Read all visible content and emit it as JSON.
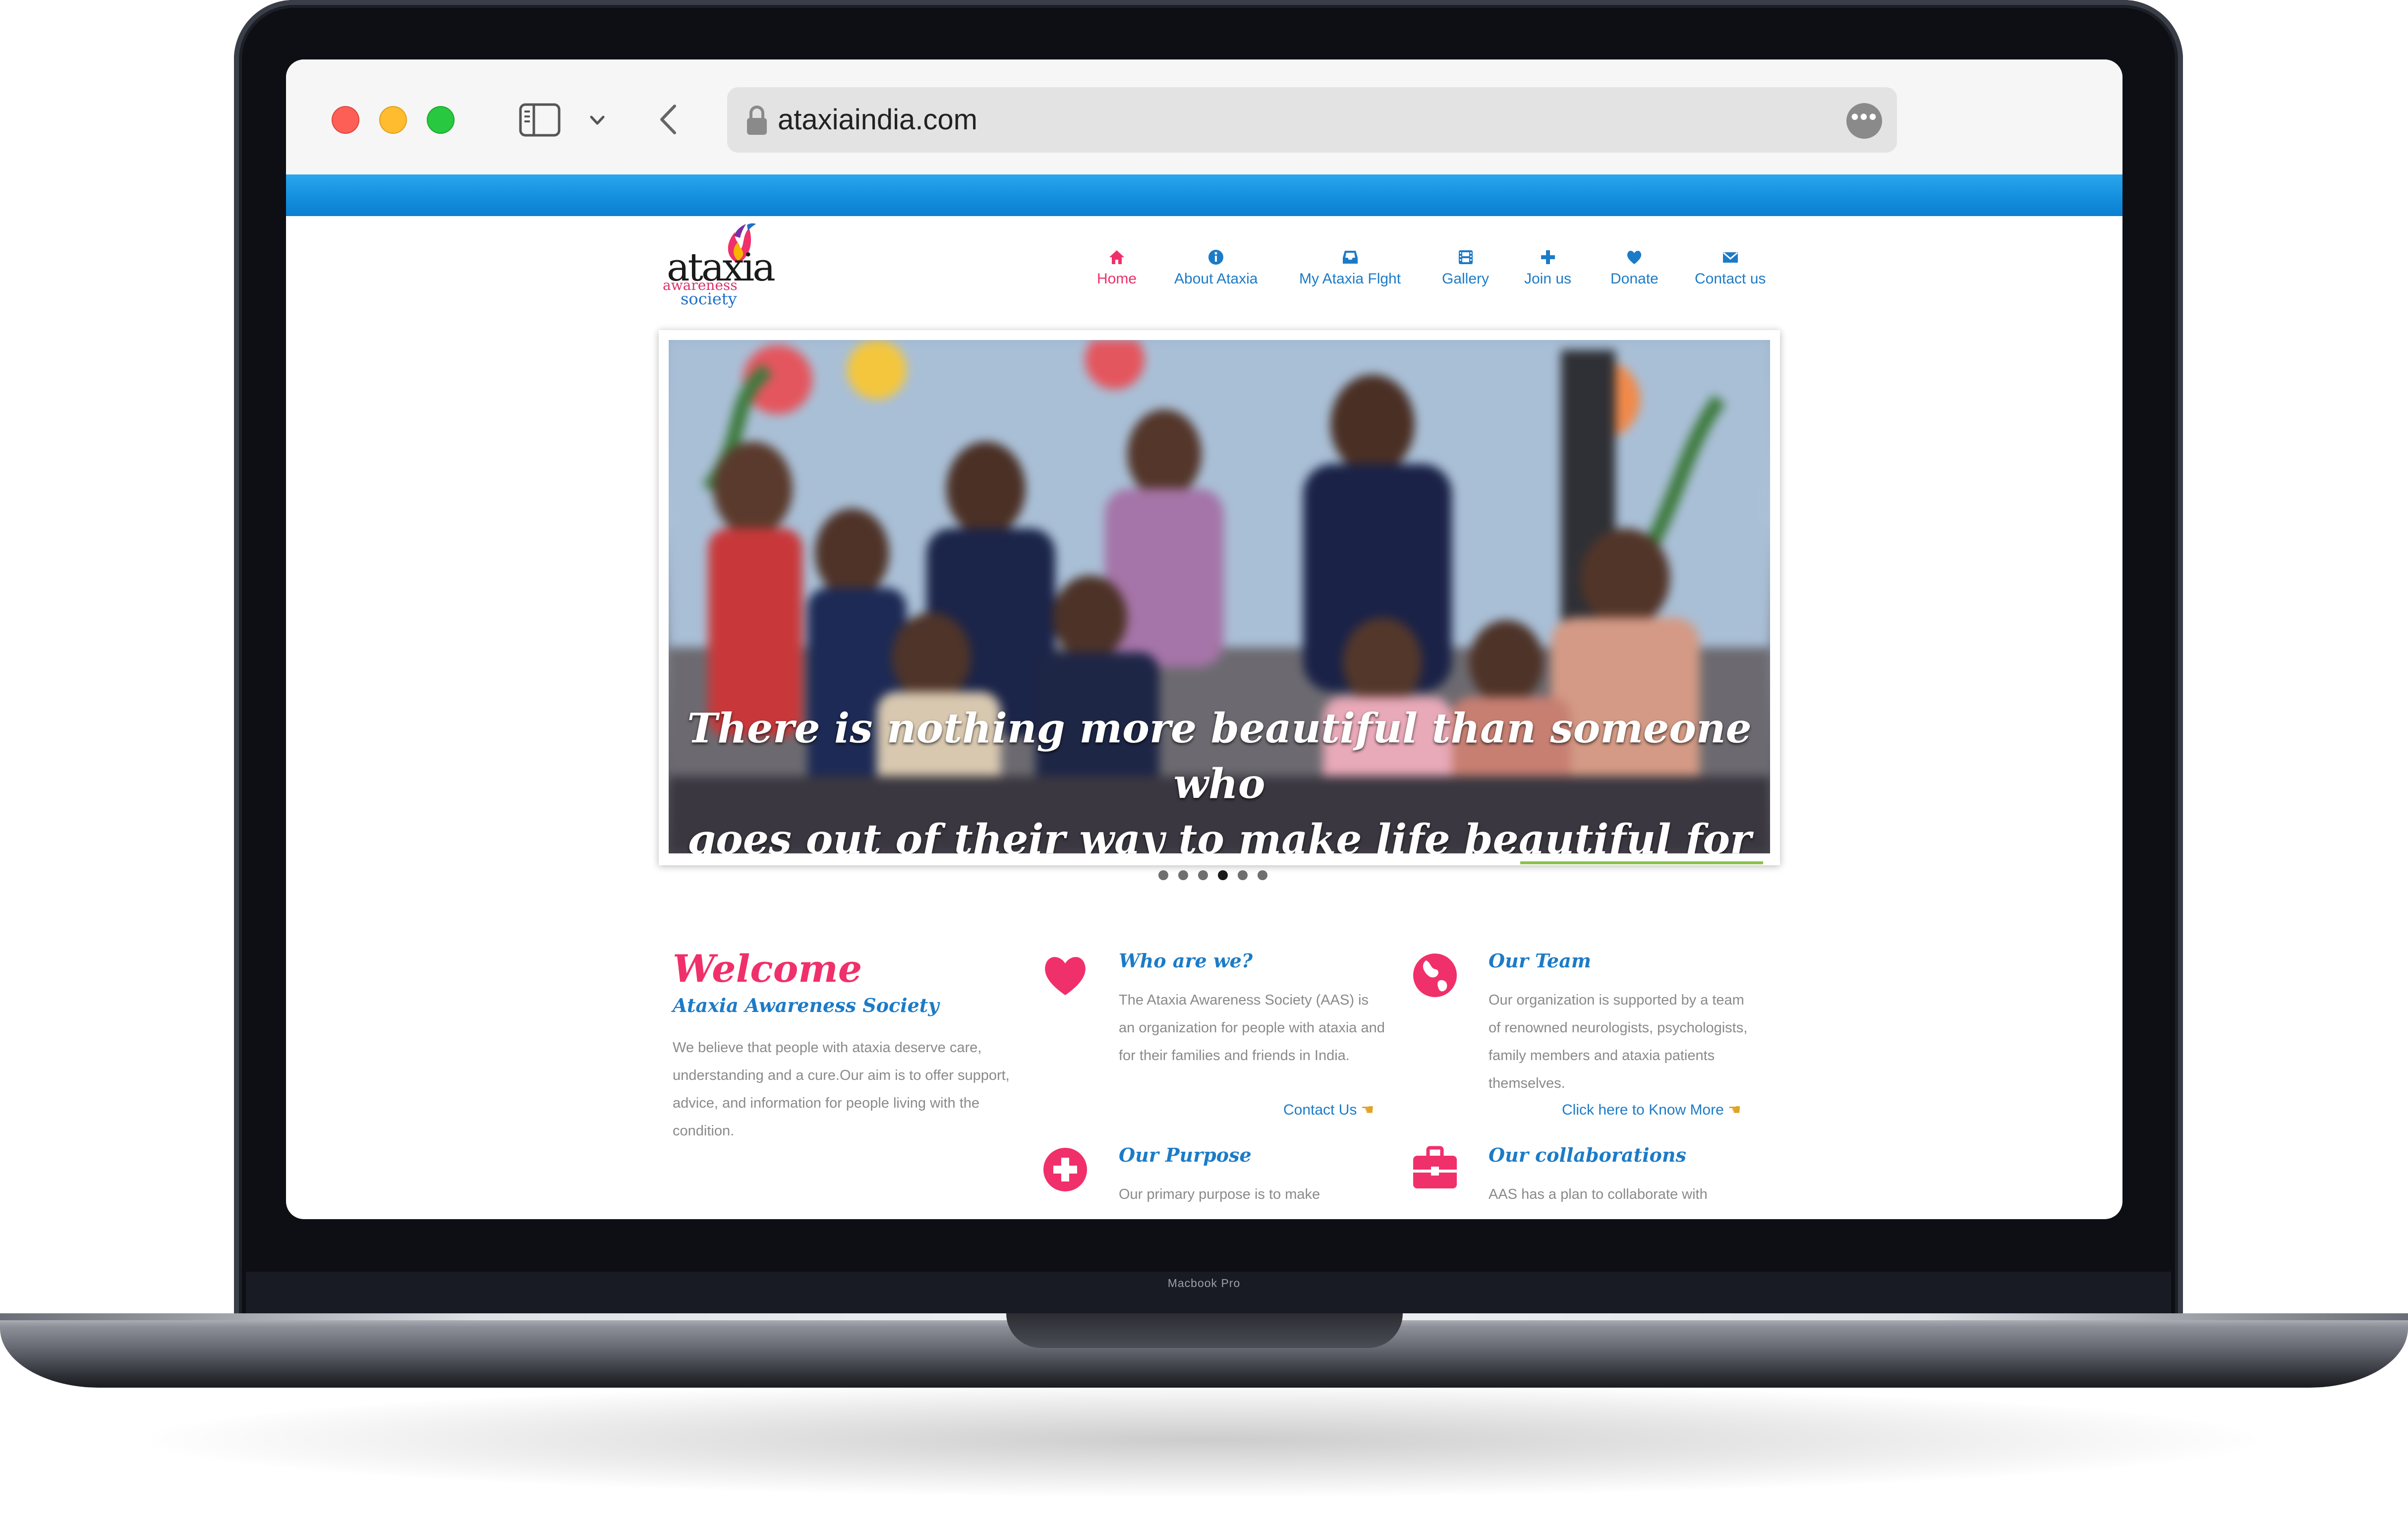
{
  "device": {
    "model_label": "Macbook Pro"
  },
  "browser": {
    "url": "ataxiaindia.com",
    "sidebar_icon": "sidebar-icon",
    "back_icon": "chevron-left-icon",
    "more_icon": "ellipsis-circle-icon"
  },
  "site": {
    "logo": {
      "word": "ataxia",
      "line2": "awareness",
      "line3": "society"
    },
    "nav": [
      {
        "label": "Home",
        "icon": "home-icon",
        "active": true
      },
      {
        "label": "About Ataxia",
        "icon": "info-circle-icon"
      },
      {
        "label": "My Ataxia Flght",
        "icon": "inbox-icon"
      },
      {
        "label": "Gallery",
        "icon": "film-icon"
      },
      {
        "label": "Join us",
        "icon": "plus-icon"
      },
      {
        "label": "Donate",
        "icon": "heart-icon"
      },
      {
        "label": "Contact us",
        "icon": "envelope-icon"
      }
    ],
    "hero": {
      "quote_line1": "There is nothing more beautiful than someone who",
      "quote_line2": "goes out of their way to make life beautiful for others.",
      "emoji": "🌹",
      "slides_total": 6,
      "active_slide": 4
    },
    "welcome": {
      "title": "Welcome",
      "subtitle": "Ataxia Awareness Society",
      "text": "We believe that people with ataxia deserve care, understanding and a cure.Our aim is to offer support, advice, and information for people living with the condition."
    },
    "features": [
      {
        "title": "Who are we?",
        "icon": "heart-icon",
        "text": "The Ataxia Awareness Society (AAS) is an organization for people with ataxia and for their families and friends in India.",
        "link": "Contact Us"
      },
      {
        "title": "Our Team",
        "icon": "globe-icon",
        "text": "Our organization is supported by a team of renowned neurologists, psychologists, family members and ataxia patients themselves.",
        "link": "Click here to Know More"
      },
      {
        "title": "Our Purpose",
        "icon": "plus-circle-icon",
        "text": "Our primary purpose is to make"
      },
      {
        "title": "Our collaborations",
        "icon": "briefcase-icon",
        "text": "AAS has a plan to collaborate with"
      }
    ],
    "colors": {
      "accent_pink": "#f0306a",
      "link_blue": "#1c7bc7",
      "top_bar_blue": "#148fdd"
    }
  }
}
